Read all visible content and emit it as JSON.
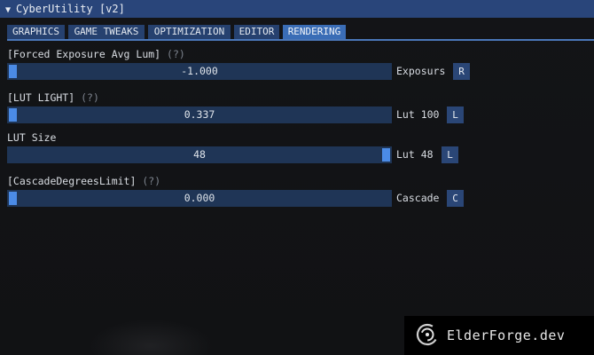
{
  "window": {
    "title": "CyberUtility [v2]",
    "collapse_glyph": "▼"
  },
  "tabs": [
    {
      "label": "GRAPHICS",
      "active": false
    },
    {
      "label": "GAME TWEAKS",
      "active": false
    },
    {
      "label": "OPTIMIZATION",
      "active": false
    },
    {
      "label": "EDITOR",
      "active": false
    },
    {
      "label": "RENDERING",
      "active": true
    }
  ],
  "settings": [
    {
      "label": "[Forced Exposure Avg Lum]",
      "help": "(?)",
      "value": "-1.000",
      "level": 0.0,
      "side_label": "Exposurs",
      "button": "R"
    },
    {
      "label": "[LUT LIGHT]",
      "help": "(?)",
      "value": "0.337",
      "level": 0.0,
      "side_label": "Lut 100",
      "button": "L"
    },
    {
      "label": "LUT Size",
      "help": "",
      "value": "48",
      "level": 1.0,
      "side_label": "Lut 48",
      "button": "L"
    },
    {
      "label": "[CascadeDegreesLimit]",
      "help": "(?)",
      "value": "0.000",
      "level": 0.0,
      "side_label": "Cascade",
      "button": "C"
    }
  ],
  "watermark": {
    "text": "ElderForge.dev",
    "logo_icon": "swirl-logo-icon"
  },
  "colors": {
    "titlebar": "#29457a",
    "tab": "#26416f",
    "tab_active": "#3a6db6",
    "slider_frame": "#1f3556",
    "slider_grab": "#4b8be6",
    "button": "#2a4676"
  }
}
